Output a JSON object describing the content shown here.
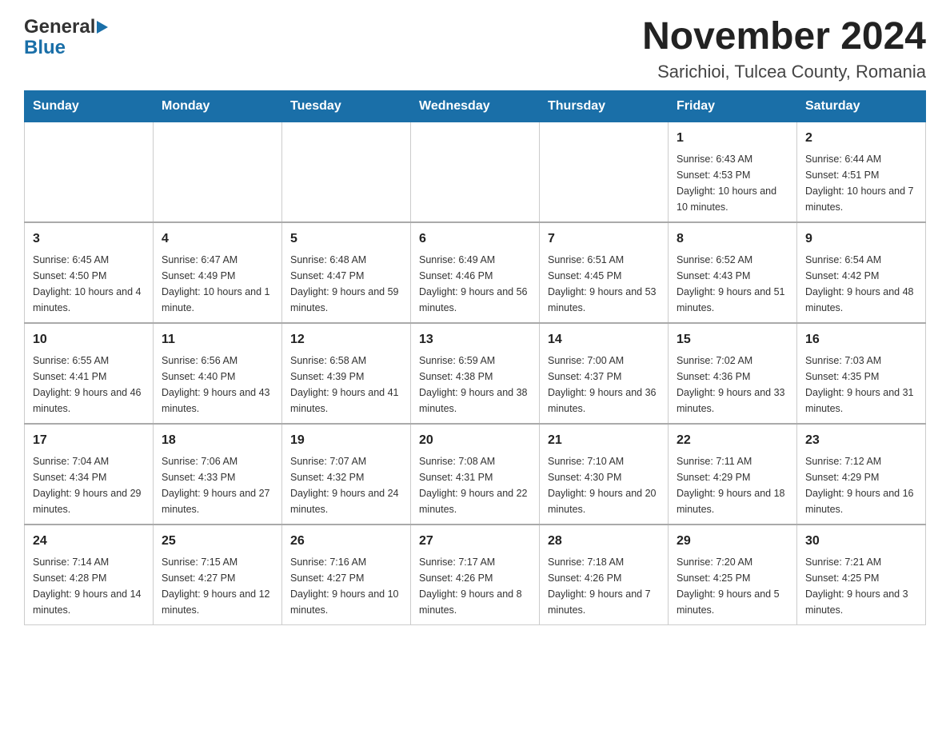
{
  "logo": {
    "general": "General",
    "blue": "Blue"
  },
  "header": {
    "title": "November 2024",
    "subtitle": "Sarichioi, Tulcea County, Romania"
  },
  "days_of_week": [
    "Sunday",
    "Monday",
    "Tuesday",
    "Wednesday",
    "Thursday",
    "Friday",
    "Saturday"
  ],
  "weeks": [
    [
      {
        "day": "",
        "info": ""
      },
      {
        "day": "",
        "info": ""
      },
      {
        "day": "",
        "info": ""
      },
      {
        "day": "",
        "info": ""
      },
      {
        "day": "",
        "info": ""
      },
      {
        "day": "1",
        "info": "Sunrise: 6:43 AM\nSunset: 4:53 PM\nDaylight: 10 hours and 10 minutes."
      },
      {
        "day": "2",
        "info": "Sunrise: 6:44 AM\nSunset: 4:51 PM\nDaylight: 10 hours and 7 minutes."
      }
    ],
    [
      {
        "day": "3",
        "info": "Sunrise: 6:45 AM\nSunset: 4:50 PM\nDaylight: 10 hours and 4 minutes."
      },
      {
        "day": "4",
        "info": "Sunrise: 6:47 AM\nSunset: 4:49 PM\nDaylight: 10 hours and 1 minute."
      },
      {
        "day": "5",
        "info": "Sunrise: 6:48 AM\nSunset: 4:47 PM\nDaylight: 9 hours and 59 minutes."
      },
      {
        "day": "6",
        "info": "Sunrise: 6:49 AM\nSunset: 4:46 PM\nDaylight: 9 hours and 56 minutes."
      },
      {
        "day": "7",
        "info": "Sunrise: 6:51 AM\nSunset: 4:45 PM\nDaylight: 9 hours and 53 minutes."
      },
      {
        "day": "8",
        "info": "Sunrise: 6:52 AM\nSunset: 4:43 PM\nDaylight: 9 hours and 51 minutes."
      },
      {
        "day": "9",
        "info": "Sunrise: 6:54 AM\nSunset: 4:42 PM\nDaylight: 9 hours and 48 minutes."
      }
    ],
    [
      {
        "day": "10",
        "info": "Sunrise: 6:55 AM\nSunset: 4:41 PM\nDaylight: 9 hours and 46 minutes."
      },
      {
        "day": "11",
        "info": "Sunrise: 6:56 AM\nSunset: 4:40 PM\nDaylight: 9 hours and 43 minutes."
      },
      {
        "day": "12",
        "info": "Sunrise: 6:58 AM\nSunset: 4:39 PM\nDaylight: 9 hours and 41 minutes."
      },
      {
        "day": "13",
        "info": "Sunrise: 6:59 AM\nSunset: 4:38 PM\nDaylight: 9 hours and 38 minutes."
      },
      {
        "day": "14",
        "info": "Sunrise: 7:00 AM\nSunset: 4:37 PM\nDaylight: 9 hours and 36 minutes."
      },
      {
        "day": "15",
        "info": "Sunrise: 7:02 AM\nSunset: 4:36 PM\nDaylight: 9 hours and 33 minutes."
      },
      {
        "day": "16",
        "info": "Sunrise: 7:03 AM\nSunset: 4:35 PM\nDaylight: 9 hours and 31 minutes."
      }
    ],
    [
      {
        "day": "17",
        "info": "Sunrise: 7:04 AM\nSunset: 4:34 PM\nDaylight: 9 hours and 29 minutes."
      },
      {
        "day": "18",
        "info": "Sunrise: 7:06 AM\nSunset: 4:33 PM\nDaylight: 9 hours and 27 minutes."
      },
      {
        "day": "19",
        "info": "Sunrise: 7:07 AM\nSunset: 4:32 PM\nDaylight: 9 hours and 24 minutes."
      },
      {
        "day": "20",
        "info": "Sunrise: 7:08 AM\nSunset: 4:31 PM\nDaylight: 9 hours and 22 minutes."
      },
      {
        "day": "21",
        "info": "Sunrise: 7:10 AM\nSunset: 4:30 PM\nDaylight: 9 hours and 20 minutes."
      },
      {
        "day": "22",
        "info": "Sunrise: 7:11 AM\nSunset: 4:29 PM\nDaylight: 9 hours and 18 minutes."
      },
      {
        "day": "23",
        "info": "Sunrise: 7:12 AM\nSunset: 4:29 PM\nDaylight: 9 hours and 16 minutes."
      }
    ],
    [
      {
        "day": "24",
        "info": "Sunrise: 7:14 AM\nSunset: 4:28 PM\nDaylight: 9 hours and 14 minutes."
      },
      {
        "day": "25",
        "info": "Sunrise: 7:15 AM\nSunset: 4:27 PM\nDaylight: 9 hours and 12 minutes."
      },
      {
        "day": "26",
        "info": "Sunrise: 7:16 AM\nSunset: 4:27 PM\nDaylight: 9 hours and 10 minutes."
      },
      {
        "day": "27",
        "info": "Sunrise: 7:17 AM\nSunset: 4:26 PM\nDaylight: 9 hours and 8 minutes."
      },
      {
        "day": "28",
        "info": "Sunrise: 7:18 AM\nSunset: 4:26 PM\nDaylight: 9 hours and 7 minutes."
      },
      {
        "day": "29",
        "info": "Sunrise: 7:20 AM\nSunset: 4:25 PM\nDaylight: 9 hours and 5 minutes."
      },
      {
        "day": "30",
        "info": "Sunrise: 7:21 AM\nSunset: 4:25 PM\nDaylight: 9 hours and 3 minutes."
      }
    ]
  ]
}
